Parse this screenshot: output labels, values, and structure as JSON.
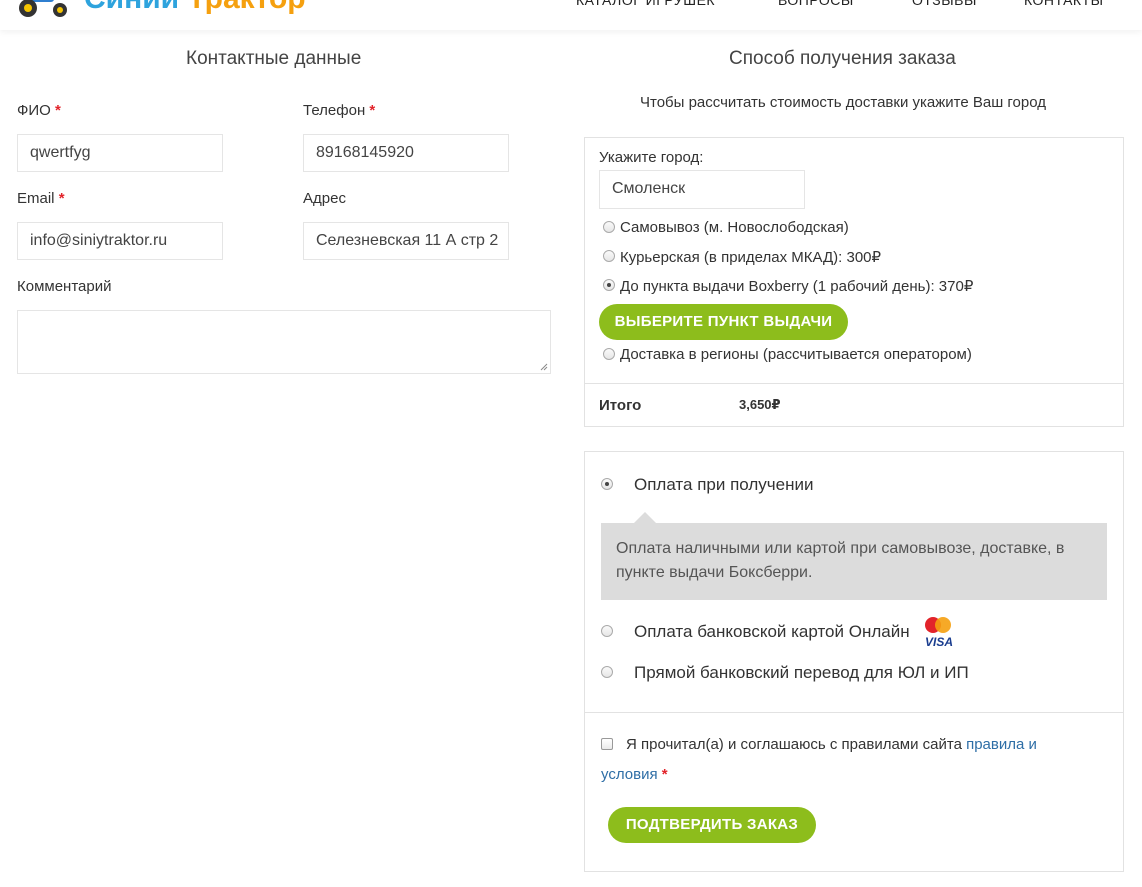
{
  "header": {
    "logo_part1": "Синий",
    "logo_part2": "Трактор",
    "nav": [
      "КАТАЛОГ ИГРУШЕК",
      "ВОПРОСЫ",
      "ОТЗЫВЫ",
      "КОНТАКТЫ"
    ]
  },
  "contacts": {
    "title": "Контактные данные",
    "fio_label": "ФИО",
    "fio_value": "qwertfyg",
    "phone_label": "Телефон",
    "phone_value": "89168145920",
    "email_label": "Email",
    "email_value": "info@siniytraktor.ru",
    "address_label": "Адрес",
    "address_value": "Селезневская 11 А стр 2",
    "comment_label": "Комментарий",
    "comment_value": "",
    "required_mark": "*"
  },
  "delivery": {
    "title": "Способ получения заказа",
    "hint": "Чтобы рассчитать стоимость доставки укажите Ваш город",
    "city_label": "Укажите город:",
    "city_value": "Смоленск",
    "options": [
      {
        "label": "Самовывоз (м. Новослободская)",
        "checked": false
      },
      {
        "label": "Курьерская (в приделах МКАД): 300₽",
        "checked": false
      },
      {
        "label": "До пункта выдачи Boxberry (1 рабочий день): 370₽",
        "checked": true
      },
      {
        "label": "Доставка в регионы (рассчитывается оператором)",
        "checked": false
      }
    ],
    "pickup_button": "ВЫБЕРИТЕ ПУНКТ ВЫДАЧИ",
    "total_label": "Итого",
    "total_value": "3,650₽"
  },
  "payment": {
    "options": [
      {
        "label": "Оплата при получении",
        "checked": true
      },
      {
        "label": "Оплата банковской картой Онлайн",
        "checked": false
      },
      {
        "label": "Прямой банковский перевод для ЮЛ и ИП",
        "checked": false
      }
    ],
    "cod_description": "Оплата наличными или картой при самовывозе, доставке, в пункте выдачи Боксберри.",
    "card_logo_text": "VISA",
    "agree_text": "Я прочитал(а) и соглашаюсь с правилами сайта",
    "agree_link": "правила и условия",
    "required_mark": "*",
    "confirm_button": "ПОДТВЕРДИТЬ ЗАКАЗ"
  },
  "colors": {
    "accent_green": "#8dbd1c",
    "required_red": "#e2232a",
    "link_blue": "#2e6ea6",
    "logo_blue": "#2ea3dd",
    "logo_orange": "#f5a00f"
  }
}
